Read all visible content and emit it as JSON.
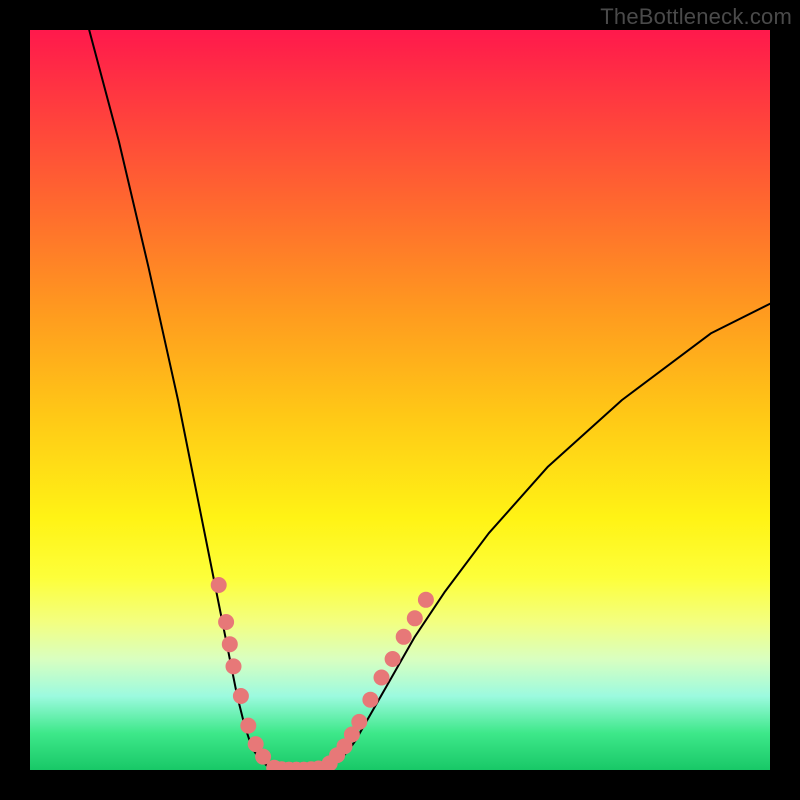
{
  "watermark": "TheBottleneck.com",
  "chart_data": {
    "type": "line",
    "title": "",
    "xlabel": "",
    "ylabel": "",
    "xlim": [
      0,
      100
    ],
    "ylim": [
      0,
      100
    ],
    "series": [
      {
        "name": "curve-left",
        "x": [
          8,
          12,
          16,
          20,
          22,
          24,
          26,
          27,
          28,
          29,
          30,
          31,
          32,
          33
        ],
        "y": [
          100,
          85,
          68,
          50,
          40,
          30,
          20,
          15,
          10,
          6,
          3,
          1.5,
          0.6,
          0.2
        ]
      },
      {
        "name": "curve-bottom",
        "x": [
          33,
          34,
          35,
          36,
          37,
          38,
          39,
          40
        ],
        "y": [
          0.2,
          0,
          0,
          0,
          0,
          0,
          0,
          0.2
        ]
      },
      {
        "name": "curve-right",
        "x": [
          40,
          41,
          42,
          43,
          44,
          46,
          48,
          52,
          56,
          62,
          70,
          80,
          92,
          100
        ],
        "y": [
          0.2,
          0.7,
          1.5,
          2.6,
          4,
          7.5,
          11,
          18,
          24,
          32,
          41,
          50,
          59,
          63
        ]
      }
    ],
    "dots_left": [
      {
        "x": 25.5,
        "y": 25
      },
      {
        "x": 26.5,
        "y": 20
      },
      {
        "x": 27,
        "y": 17
      },
      {
        "x": 27.5,
        "y": 14
      },
      {
        "x": 28.5,
        "y": 10
      },
      {
        "x": 29.5,
        "y": 6
      },
      {
        "x": 30.5,
        "y": 3.5
      },
      {
        "x": 31.5,
        "y": 1.8
      }
    ],
    "dots_bottom": [
      {
        "x": 33,
        "y": 0.3
      },
      {
        "x": 34,
        "y": 0.1
      },
      {
        "x": 35,
        "y": 0.05
      },
      {
        "x": 36,
        "y": 0.05
      },
      {
        "x": 37,
        "y": 0.05
      },
      {
        "x": 38,
        "y": 0.1
      },
      {
        "x": 39,
        "y": 0.2
      }
    ],
    "dots_right": [
      {
        "x": 40.5,
        "y": 0.9
      },
      {
        "x": 41.5,
        "y": 2
      },
      {
        "x": 42.5,
        "y": 3.2
      },
      {
        "x": 43.5,
        "y": 4.8
      },
      {
        "x": 44.5,
        "y": 6.5
      },
      {
        "x": 46,
        "y": 9.5
      },
      {
        "x": 47.5,
        "y": 12.5
      },
      {
        "x": 49,
        "y": 15
      },
      {
        "x": 50.5,
        "y": 18
      },
      {
        "x": 52,
        "y": 20.5
      },
      {
        "x": 53.5,
        "y": 23
      }
    ],
    "dot_style": {
      "color": "#e77878",
      "radius": 8
    },
    "curve_style": {
      "color": "#000000",
      "width": 2
    }
  }
}
